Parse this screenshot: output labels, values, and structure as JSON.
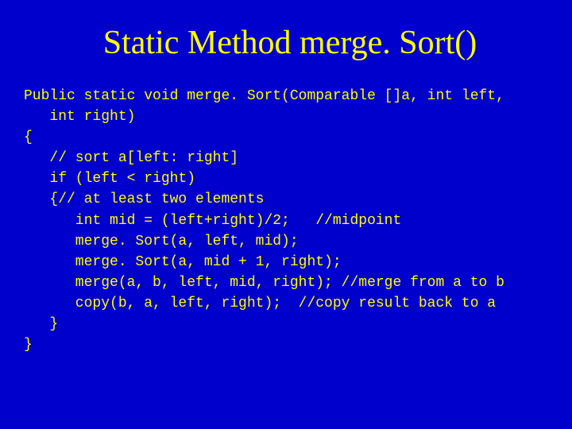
{
  "slide": {
    "title": "Static Method merge. Sort()",
    "code": {
      "line1": "Public static void merge. Sort(Comparable []a, int left,",
      "line2": "   int right)",
      "line3": "{",
      "line4": "   // sort a[left: right]",
      "line5": "   if (left < right)",
      "line6": "   {// at least two elements",
      "line7": "      int mid = (left+right)/2;   //midpoint",
      "line8": "      merge. Sort(a, left, mid);",
      "line9": "      merge. Sort(a, mid + 1, right);",
      "line10": "      merge(a, b, left, mid, right); //merge from a to b",
      "line11": "      copy(b, a, left, right);  //copy result back to a",
      "line12": "   }",
      "line13": "}"
    }
  }
}
